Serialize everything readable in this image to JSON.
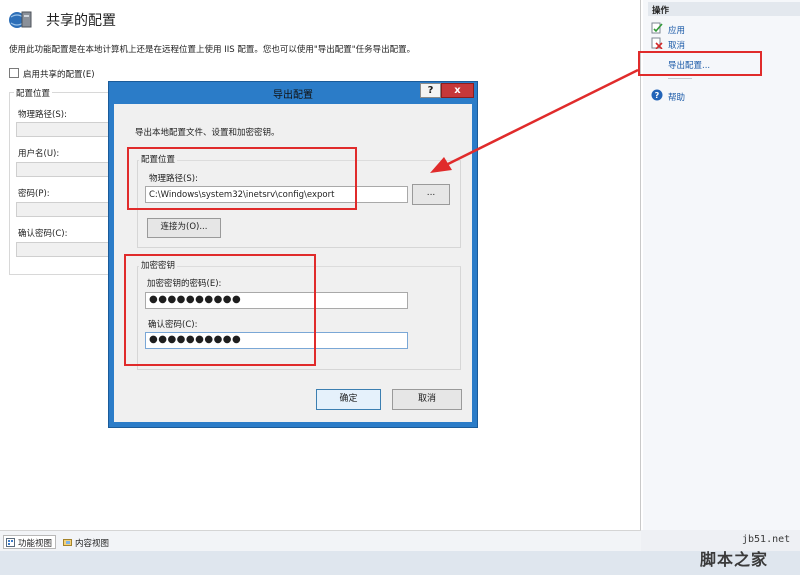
{
  "main": {
    "title": "共享的配置",
    "description": "使用此功能配置是在本地计算机上还是在远程位置上使用 IIS 配置。您也可以使用\"导出配置\"任务导出配置。",
    "enable_label": "启用共享的配置(E)",
    "group_label": "配置位置",
    "fields": [
      {
        "label": "物理路径(S):"
      },
      {
        "label": "用户名(U):"
      },
      {
        "label": "密码(P):"
      },
      {
        "label": "确认密码(C):"
      }
    ]
  },
  "actions": {
    "header": "操作",
    "items": [
      {
        "label": "应用",
        "icon": "apply-icon"
      },
      {
        "label": "取消",
        "icon": "cancel-icon"
      },
      {
        "label": "导出配置...",
        "icon": ""
      },
      {
        "label": "帮助",
        "icon": "help-icon"
      }
    ]
  },
  "bottom_tabs": [
    {
      "label": "功能视图",
      "icon": "features-view-icon"
    },
    {
      "label": "内容视图",
      "icon": "content-view-icon"
    }
  ],
  "dialog": {
    "title": "导出配置",
    "help_label": "?",
    "close_label": "x",
    "description": "导出本地配置文件、设置和加密密钥。",
    "location_group": "配置位置",
    "path_label": "物理路径(S):",
    "path_value": "C:\\Windows\\system32\\inetsrv\\config\\export",
    "browse_label": "...",
    "connect_label": "连接为(O)...",
    "key_group": "加密密钥",
    "key_password_label": "加密密钥的密码(E):",
    "key_password_value": "●●●●●●●●●●",
    "confirm_label": "确认密码(C):",
    "confirm_value": "●●●●●●●●●●",
    "ok_label": "确定",
    "cancel_label": "取消"
  },
  "watermark": {
    "url": "jb51.net",
    "text": "脚本之家"
  },
  "colors": {
    "dialog_frame": "#2b7cc8",
    "close_button": "#c7383a",
    "annotation_red": "#e02b2b",
    "link_blue": "#1a5aa8"
  }
}
